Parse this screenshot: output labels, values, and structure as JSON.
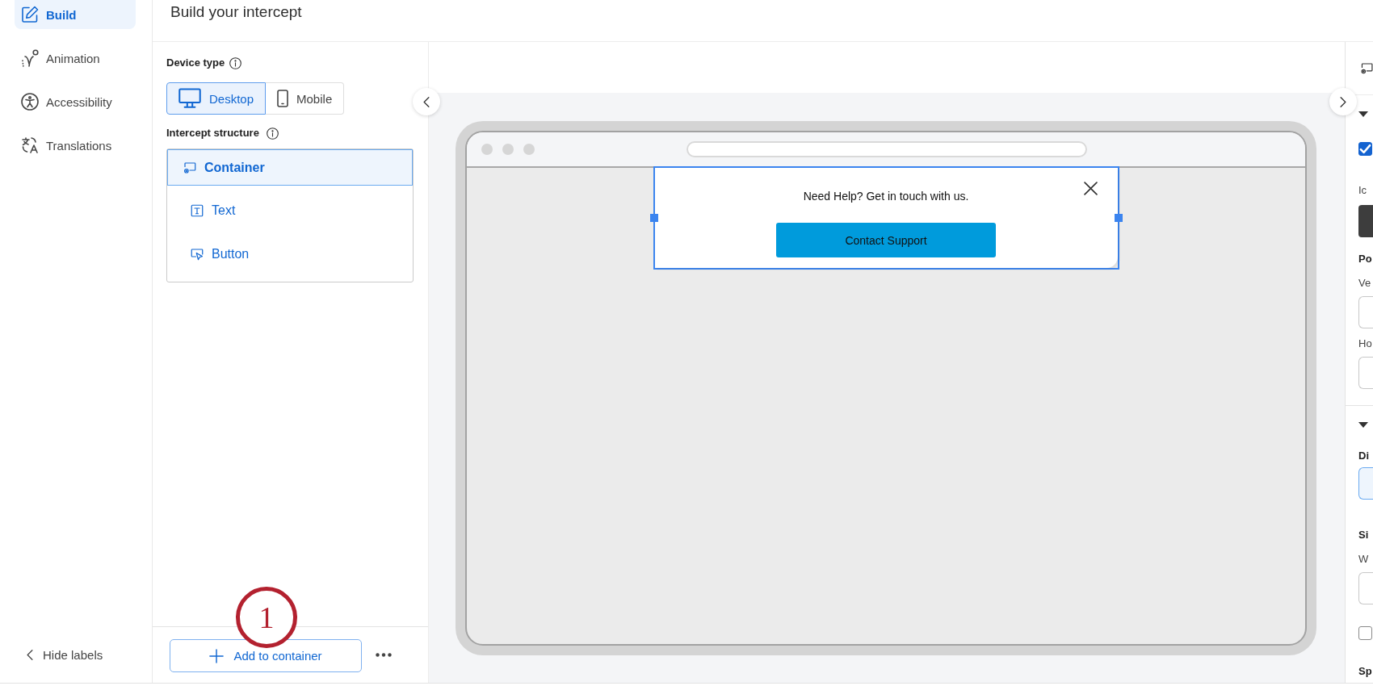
{
  "nav": {
    "items": [
      {
        "kind": "build",
        "label": "Build",
        "selected": true
      },
      {
        "kind": "animation",
        "label": "Animation",
        "selected": false
      },
      {
        "kind": "accessibility",
        "label": "Accessibility",
        "selected": false
      },
      {
        "kind": "translations",
        "label": "Translations",
        "selected": false
      }
    ],
    "hide_labels": "Hide labels"
  },
  "header": {
    "title": "Build your intercept"
  },
  "build_panel": {
    "device_type": {
      "label": "Device type",
      "options": [
        {
          "kind": "desktop",
          "label": "Desktop",
          "selected": true
        },
        {
          "kind": "mobile",
          "label": "Mobile",
          "selected": false
        }
      ]
    },
    "structure": {
      "label": "Intercept structure",
      "items": [
        {
          "kind": "container",
          "label": "Container",
          "selected": true,
          "children": [
            {
              "kind": "text",
              "label": "Text",
              "selected": false
            },
            {
              "kind": "button",
              "label": "Button",
              "selected": false
            }
          ]
        }
      ]
    },
    "footer": {
      "add_button": "Add to container"
    }
  },
  "preview": {
    "popup": {
      "selected": true,
      "message": "Need Help? Get in touch with us.",
      "button": "Contact Support"
    }
  },
  "settings_panel": {
    "sections": [
      {
        "expanded": true,
        "rows": [
          {
            "kind": "checkbox",
            "checked": true
          },
          {
            "kind": "label",
            "text": "Ic"
          },
          {
            "kind": "swatch"
          },
          {
            "kind": "heading",
            "text": "Po"
          },
          {
            "kind": "label",
            "text": "Ve"
          },
          {
            "kind": "field",
            "selected": false
          },
          {
            "kind": "label",
            "text": "Ho"
          },
          {
            "kind": "field",
            "selected": false
          }
        ]
      },
      {
        "expanded": true,
        "rows": [
          {
            "kind": "heading",
            "text": "Di"
          },
          {
            "kind": "field",
            "selected": true
          },
          {
            "kind": "heading",
            "text": "Si"
          },
          {
            "kind": "label",
            "text": "W"
          },
          {
            "kind": "field",
            "selected": false
          },
          {
            "kind": "checkbox",
            "checked": false
          },
          {
            "kind": "heading",
            "text": "Sp"
          }
        ]
      }
    ]
  },
  "annotation": {
    "label": "1"
  }
}
